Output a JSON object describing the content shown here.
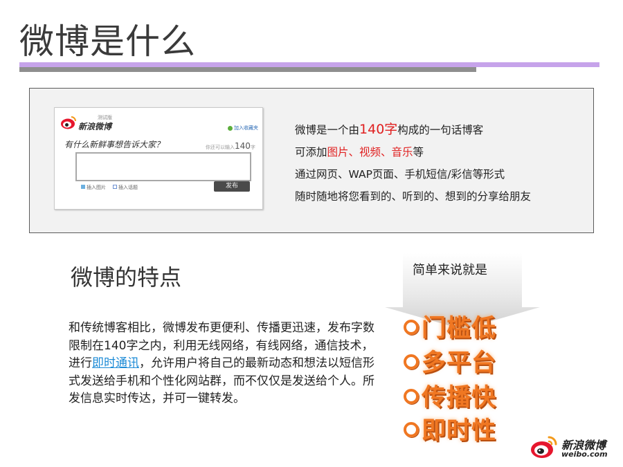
{
  "title": "微博是什么",
  "screenshot": {
    "beta_label": "测试版",
    "brand": "新浪微博",
    "favorite": "加入收藏夹",
    "prompt": "有什么新鲜事想告诉大家？",
    "counter_prefix": "你还可以输入",
    "counter_value": "140",
    "counter_suffix": "字",
    "tool_image": "插入图片",
    "tool_topic": "插入话题",
    "publish": "发布"
  },
  "description": {
    "line1_a": "微博是一个由",
    "line1_highlight": "140字",
    "line1_b": "构成的一句话博客",
    "line2_a": "可添加",
    "line2_highlight": "图片、视频、音乐",
    "line2_b": "等",
    "line3": "通过网页、WAP页面、手机短信/彩信等形式",
    "line4": "随时随地将您看到的、听到的、想到的分享给朋友"
  },
  "features_title": "微博的特点",
  "features_paragraph": {
    "part1": "和传统博客相比，微博发布更便利、传播更迅速，发布字数限制在140字之内，利用无线网络，有线网络，通信技术，进行",
    "link": "即时通讯",
    "part2": "，允许用户将自己的最新动态和想法以短信形式发送给手机和个性化网站群，而不仅仅是发送给个人。所发信息实时传达，并可一键转发。"
  },
  "callout": "简单来说就是",
  "features": [
    "门槛低",
    "多平台",
    "传播快",
    "即时性"
  ],
  "footer_logo": {
    "brand": "新浪微博",
    "domain": "weibo.com"
  },
  "colors": {
    "accent_bar": "#c6a3ea",
    "dark_bar": "#8e8e8e",
    "highlight_red": "#e02020",
    "feature_orange": "#f07722",
    "link_blue": "#1b8ad6"
  }
}
